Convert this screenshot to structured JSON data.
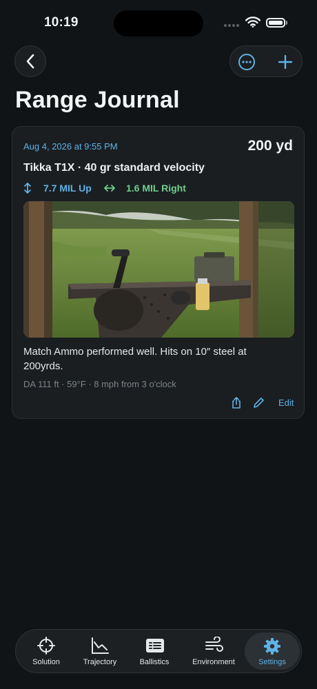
{
  "status_bar": {
    "time": "10:19"
  },
  "nav": {
    "back_icon": "chevron-left-icon",
    "more_icon": "ellipsis-circle-icon",
    "add_icon": "plus-icon"
  },
  "page": {
    "title": "Range Journal"
  },
  "entry": {
    "date": "Aug 4, 2026 at 9:55 PM",
    "distance": "200 yd",
    "rifle": "Tikka T1X · 40 gr standard velocity",
    "elevation": "7.7 MIL Up",
    "windage": "1.6 MIL Right",
    "notes": "Match Ammo performed well. Hits on 10″ steel at 200yrds.",
    "conditions": "DA 111 ft · 59°F · 8 mph from 3 o'clock",
    "edit_label": "Edit",
    "photo_icon": "range-photo-image"
  },
  "tabs": [
    {
      "label": "Solution",
      "icon": "crosshair-icon"
    },
    {
      "label": "Trajectory",
      "icon": "chart-icon"
    },
    {
      "label": "Ballistics",
      "icon": "list-card-icon"
    },
    {
      "label": "Environment",
      "icon": "wind-icon"
    },
    {
      "label": "Settings",
      "icon": "gear-icon",
      "active": true
    }
  ],
  "colors": {
    "background": "#111416",
    "card": "#1a1e21",
    "accent_blue": "#5fb3e6",
    "accent_green": "#6fcf8e"
  }
}
